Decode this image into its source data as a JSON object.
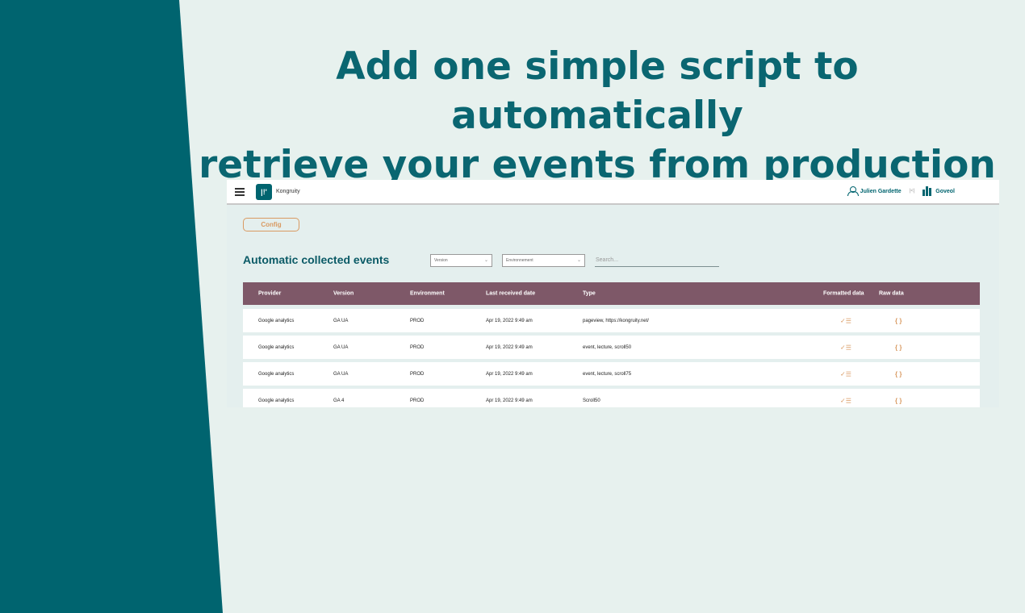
{
  "headline": {
    "line1": "Add one simple script to automatically",
    "line2": "retrieve your events from production"
  },
  "app": {
    "brand": "Kongruity",
    "logo_text": "|!'",
    "user_name": "Julien Gardette",
    "separator": "|<|",
    "org_name": "Goveol",
    "config_label": "Config",
    "section_title": "Automatic collected events",
    "version_select": "Version",
    "environment_select": "Environnement",
    "search_placeholder": "Search...",
    "columns": [
      "Provider",
      "Version",
      "Environment",
      "Last received date",
      "Type",
      "Formatted data",
      "Raw data"
    ],
    "rows": [
      [
        "Google analytics",
        "GA UA",
        "PROD",
        "Apr 19, 2022 9:49 am",
        "pageview, https://kongruity.net/"
      ],
      [
        "Google analytics",
        "GA UA",
        "PROD",
        "Apr 19, 2022 9:49 am",
        "event, lecture, scroll50"
      ],
      [
        "Google analytics",
        "GA UA",
        "PROD",
        "Apr 19, 2022 9:49 am",
        "event, lecture, scroll75"
      ],
      [
        "Google analytics",
        "GA 4",
        "PROD",
        "Apr 19, 2022 9:49 am",
        "Scroll50"
      ]
    ],
    "formatted_icon": "✓☰",
    "raw_icon": "{ }",
    "chevron": "⌄"
  }
}
